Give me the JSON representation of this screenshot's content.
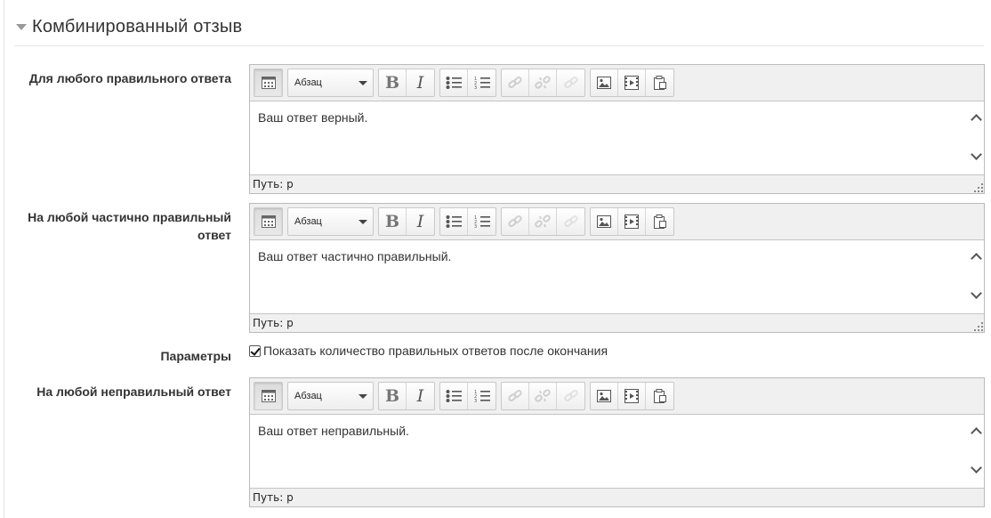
{
  "section": {
    "title": "Комбинированный отзыв"
  },
  "toolbar": {
    "format_select": "Абзац"
  },
  "editors": [
    {
      "label": "Для любого правильного ответа",
      "content": "Ваш ответ верный.",
      "path_label": "Путь:",
      "path_value": "p"
    },
    {
      "label": "На любой частично правильный ответ",
      "content": "Ваш ответ частично правильный.",
      "path_label": "Путь:",
      "path_value": "p"
    },
    {
      "label": "На любой неправильный ответ",
      "content": "Ваш ответ неправильный.",
      "path_label": "Путь:",
      "path_value": "p"
    }
  ],
  "params": {
    "label": "Параметры",
    "checkbox_label": "Показать количество правильных ответов после окончания",
    "checked": true
  },
  "icons": [
    "toolbar-toggle-icon",
    "bold-icon",
    "italic-icon",
    "bullet-list-icon",
    "numbered-list-icon",
    "link-icon",
    "unlink-icon",
    "anchor-icon",
    "image-icon",
    "media-icon",
    "paste-icon"
  ]
}
